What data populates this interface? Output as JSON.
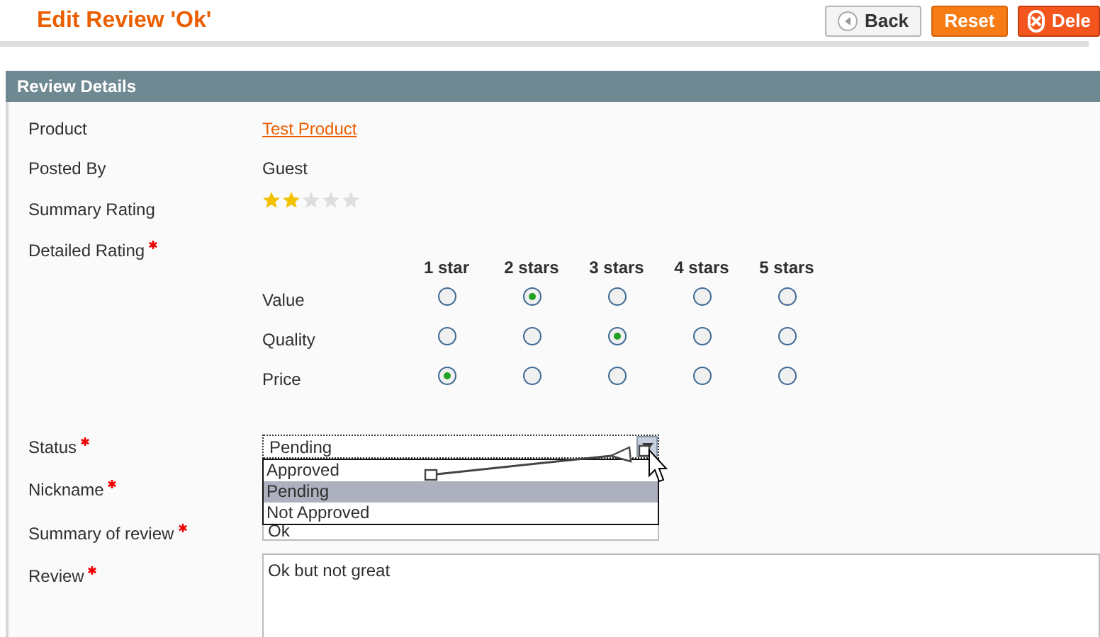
{
  "page_title": "Edit Review 'Ok'",
  "buttons": [
    {
      "label": "Back",
      "kind": "back"
    },
    {
      "label": "Reset",
      "kind": "reset"
    },
    {
      "label": "Dele",
      "kind": "delete"
    }
  ],
  "section": {
    "title": "Review Details"
  },
  "product": {
    "label": "Product",
    "value": "Test Product"
  },
  "posted_by": {
    "label": "Posted By",
    "value": "Guest"
  },
  "summary_rating": {
    "label": "Summary Rating",
    "stars": 2
  },
  "detailed_rating": {
    "label": "Detailed Rating",
    "required": true,
    "columns": [
      "1 star",
      "2 stars",
      "3 stars",
      "4 stars",
      "5 stars"
    ],
    "rows": [
      {
        "label": "Value",
        "choices": [
          {
            "selected": false
          },
          {
            "selected": true
          },
          {
            "selected": false
          },
          {
            "selected": false
          },
          {
            "selected": false
          }
        ]
      },
      {
        "label": "Quality",
        "choices": [
          {
            "selected": false
          },
          {
            "selected": false
          },
          {
            "selected": true
          },
          {
            "selected": false
          },
          {
            "selected": false
          }
        ]
      },
      {
        "label": "Price",
        "choices": [
          {
            "selected": true
          },
          {
            "selected": false
          },
          {
            "selected": false
          },
          {
            "selected": false
          },
          {
            "selected": false
          }
        ]
      }
    ]
  },
  "status": {
    "label": "Status",
    "required": true,
    "value": "Pending",
    "expanded": true,
    "options": [
      {
        "label": "Approved",
        "selected": false
      },
      {
        "label": "Pending",
        "selected": true
      },
      {
        "label": "Not Approved",
        "selected": false
      }
    ]
  },
  "nickname": {
    "label": "Nickname",
    "required": true
  },
  "summary_of_review": {
    "label": "Summary of review",
    "required": true,
    "value": "Ok"
  },
  "review": {
    "label": "Review",
    "required": true,
    "value": "Ok but not great"
  }
}
